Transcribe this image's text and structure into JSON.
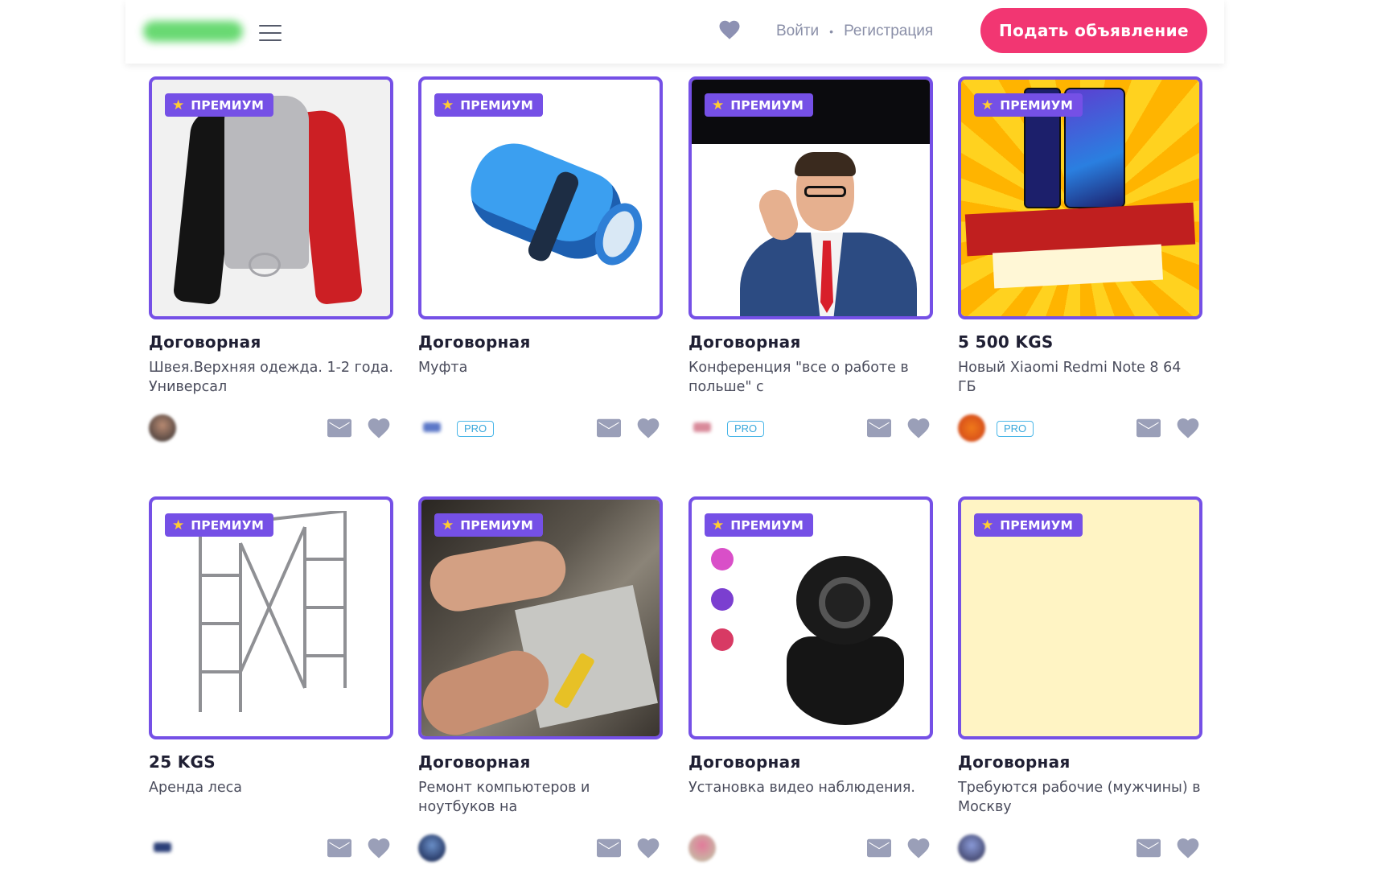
{
  "header": {
    "login": "Войти",
    "separator": "•",
    "register": "Регистрация",
    "post_ad": "Подать объявление"
  },
  "badge_label": "ПРЕМИУМ",
  "pro_label": "PRO",
  "colors": {
    "accent": "#7550e6",
    "cta": "#f23672",
    "pro": "#49b6e8",
    "icon": "#9a9fb8"
  },
  "listings": [
    {
      "price": "Договорная",
      "title": "Швея.Верхняя одежда. 1-2 года. Универсал",
      "pro": false
    },
    {
      "price": "Договорная",
      "title": "Муфта",
      "pro": true
    },
    {
      "price": "Договорная",
      "title": "Конференция \"все о работе в польше\" с",
      "pro": true
    },
    {
      "price": "5 500 KGS",
      "title": "Новый Xiaomi Redmi Note 8 64 ГБ",
      "pro": true
    },
    {
      "price": "25 KGS",
      "title": "Аренда леса",
      "pro": false
    },
    {
      "price": "Договорная",
      "title": "Ремонт компьютеров и ноутбуков на",
      "pro": false
    },
    {
      "price": "Договорная",
      "title": "Установка видео наблюдения.",
      "pro": false
    },
    {
      "price": "Договорная",
      "title": "Требуются рабочие (мужчины) в Москву",
      "pro": false
    }
  ]
}
